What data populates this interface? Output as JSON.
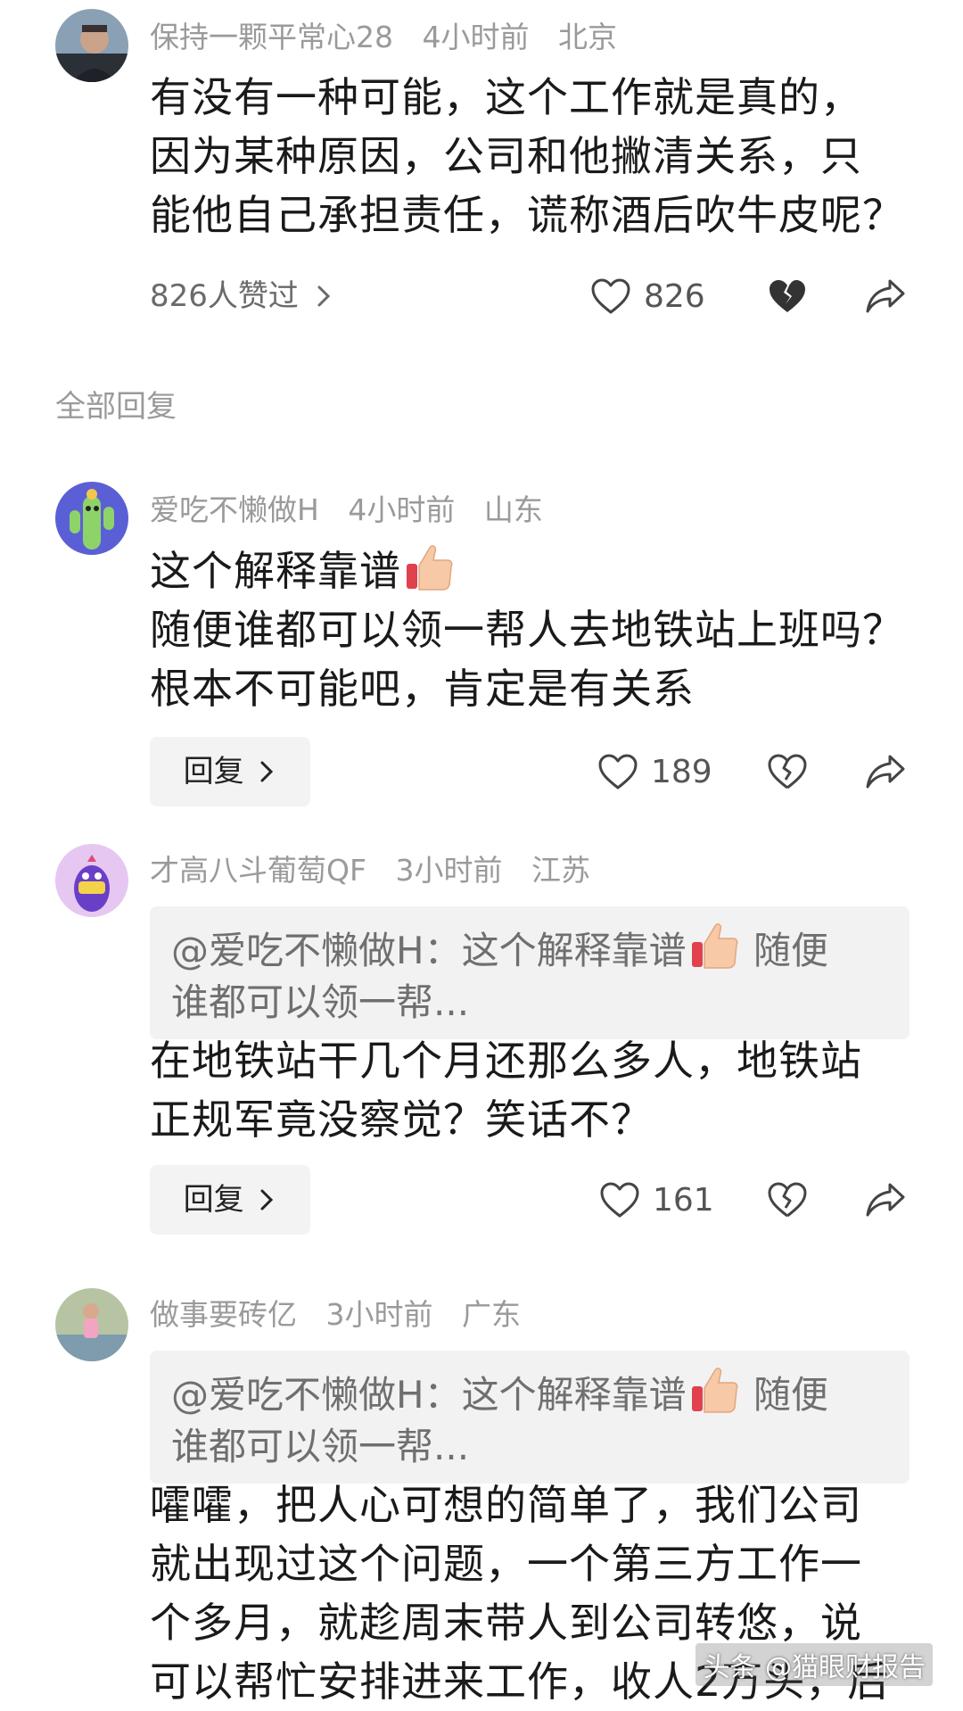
{
  "comments": [
    {
      "username": "保持一颗平常心28",
      "time": "4小时前",
      "location": "北京",
      "text_lines": [
        "有没有一种可能，这个工作就是真的，",
        "因为某种原因，公司和他撇清关系，只",
        "能他自己承担责任，谎称酒后吹牛皮呢？"
      ],
      "liked_by": "826人赞过",
      "likes": "826"
    }
  ],
  "section": {
    "title": "全部回复"
  },
  "replies": [
    {
      "username": "爱吃不懒做H",
      "time": "4小时前",
      "location": "山东",
      "text_lines": [
        "这个解释靠谱",
        "随便谁都可以领一帮人去地铁站上班吗？",
        "根本不可能吧，肯定是有关系"
      ],
      "reply_label": "回复",
      "likes": "189"
    },
    {
      "username": "才高八斗葡萄QF",
      "time": "3小时前",
      "location": "江苏",
      "quote_lines": [
        "@爱吃不懒做H：这个解释靠谱",
        "随便",
        "谁都可以领一帮..."
      ],
      "text_lines": [
        "在地铁站干几个月还那么多人，地铁站",
        "正规军竟没察觉？笑话不？"
      ],
      "reply_label": "回复",
      "likes": "161"
    },
    {
      "username": "做事要砖亿",
      "time": "3小时前",
      "location": "广东",
      "quote_lines": [
        "@爱吃不懒做H：这个解释靠谱",
        "随便",
        "谁都可以领一帮..."
      ],
      "text_lines": [
        "嚯嚯，把人心可想的简单了，我们公司",
        "就出现过这个问题，一个第三方工作一",
        "个多月，就趁周末带人到公司转悠，说",
        "可以帮忙安排进来工作，收人2万头，后"
      ]
    }
  ],
  "watermark": "头条 @猫眼财报告",
  "icons": {
    "like": "heart-outline-icon",
    "dislike": "broken-heart-icon",
    "share": "share-arrow-icon",
    "chevron": "chevron-right-icon",
    "thumb": "thumbs-up-emoji-icon"
  },
  "colors": {
    "meta_gray": "#9a9a9a",
    "text": "#1a1a1a",
    "quote_bg": "#f2f2f2",
    "reply_bg": "#f3f3f3"
  }
}
